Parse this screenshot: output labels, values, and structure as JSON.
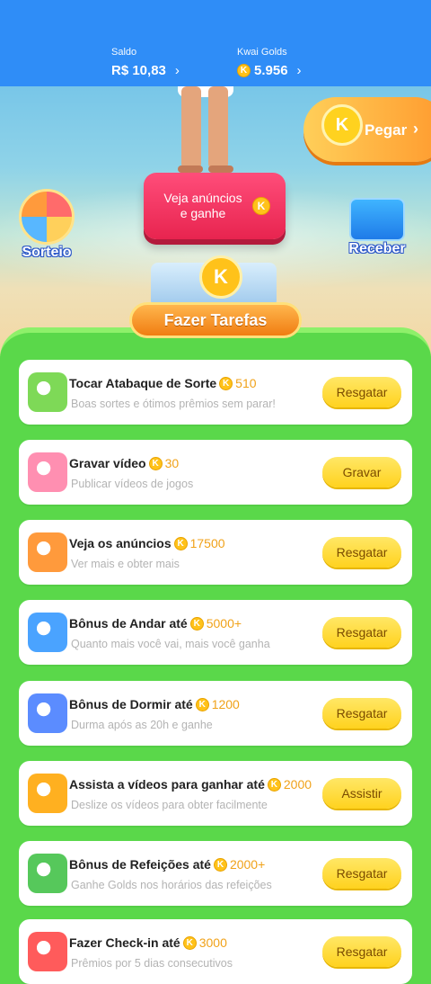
{
  "header": {
    "saldo_label": "Saldo",
    "saldo_value": "R$ 10,83",
    "golds_label": "Kwai Golds",
    "golds_value": "5.956",
    "chevron": "›"
  },
  "hero": {
    "ad_button": "Veja anúncios e ganhe",
    "pegar": "Pegar",
    "sorteio": "Sorteio",
    "receber": "Receber",
    "tasks_banner": "Fazer Tarefas",
    "k_glyph": "K"
  },
  "tasks": [
    {
      "title": "Tocar Atabaque de Sorte",
      "amount": "510",
      "subtitle": "Boas sortes e ótimos prêmios sem parar!",
      "button": "Resgatar",
      "icon": "drum-icon"
    },
    {
      "title": "Gravar vídeo",
      "amount": "30",
      "subtitle": "Publicar vídeos de jogos",
      "button": "Gravar",
      "icon": "camera-record-icon"
    },
    {
      "title": "Veja os anúncios",
      "amount": "17500",
      "subtitle": "Ver mais e obter mais",
      "button": "Resgatar",
      "icon": "tv-ad-icon"
    },
    {
      "title": "Bônus de Andar até",
      "amount": "5000+",
      "subtitle": "Quanto mais você vai, mais você ganha",
      "button": "Resgatar",
      "icon": "walking-icon"
    },
    {
      "title": "Bônus de Dormir até",
      "amount": "1200",
      "subtitle": "Durma após as 20h e ganhe",
      "button": "Resgatar",
      "icon": "moon-sleep-icon"
    },
    {
      "title": "Assista a vídeos para ganhar até",
      "amount": "2000",
      "subtitle": "Deslize os vídeos para obter facilmente",
      "button": "Assistir",
      "icon": "video-camera-icon"
    },
    {
      "title": "Bônus de Refeições até",
      "amount": "2000+",
      "subtitle": "Ganhe Golds nos horários das refeições",
      "button": "Resgatar",
      "icon": "meal-icon"
    },
    {
      "title": "Fazer Check-in até",
      "amount": "3000",
      "subtitle": "Prêmios por 5 dias consecutivos",
      "button": "Resgatar",
      "icon": "calendar-icon"
    }
  ],
  "colors": {
    "accent": "#2f8df7",
    "green": "#5ad84a",
    "button": "#ffd21e"
  }
}
